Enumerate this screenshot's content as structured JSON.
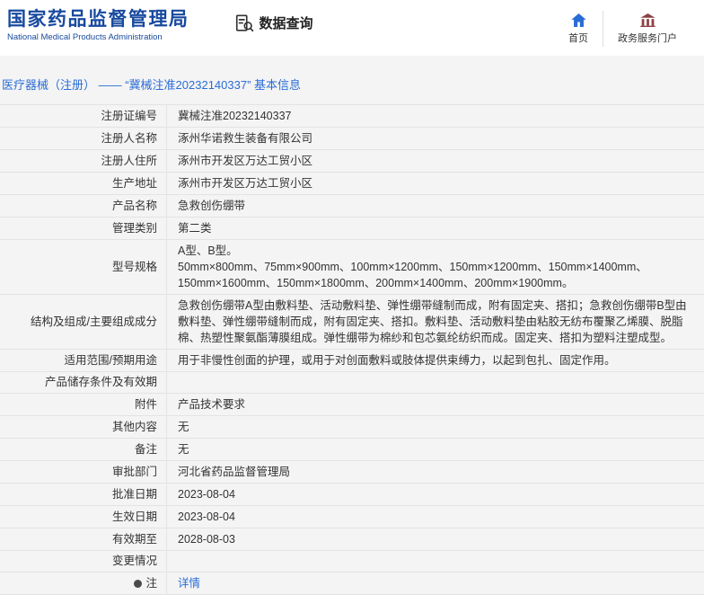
{
  "colors": {
    "logo_blue": "#17499e",
    "breadcrumb_blue": "#2a6cd5",
    "link_blue": "#2a6cd5",
    "portal_icon_red": "#8b4044"
  },
  "header": {
    "logo_title": "国家药品监督管理局",
    "logo_subtitle": "National Medical Products Administration",
    "nav_query": "数据查询",
    "home_label": "首页",
    "portal_label": "政务服务门户"
  },
  "breadcrumb": {
    "text": "医疗器械（注册） ——  “冀械注准20232140337”  基本信息"
  },
  "table": {
    "rows": [
      {
        "label": "注册证编号",
        "value": "冀械注准20232140337"
      },
      {
        "label": "注册人名称",
        "value": "涿州华诺救生装备有限公司"
      },
      {
        "label": "注册人住所",
        "value": "涿州市开发区万达工贸小区"
      },
      {
        "label": "生产地址",
        "value": "涿州市开发区万达工贸小区"
      },
      {
        "label": "产品名称",
        "value": "急救创伤绷带"
      },
      {
        "label": "管理类别",
        "value": "第二类"
      },
      {
        "label": "型号规格",
        "value": "A型、B型。\n50mm×800mm、75mm×900mm、100mm×1200mm、150mm×1200mm、150mm×1400mm、150mm×1600mm、150mm×1800mm、200mm×1400mm、200mm×1900mm。"
      },
      {
        "label": "结构及组成/主要组成成分",
        "value": "急救创伤绷带A型由敷料垫、活动敷料垫、弹性绷带缝制而成，附有固定夹、搭扣；急救创伤绷带B型由敷料垫、弹性绷带缝制而成，附有固定夹、搭扣。敷料垫、活动敷料垫由粘胶无纺布覆聚乙烯膜、脱脂棉、热塑性聚氨酯薄膜组成。弹性绷带为棉纱和包芯氨纶纺织而成。固定夹、搭扣为塑料注塑成型。"
      },
      {
        "label": "适用范围/预期用途",
        "value": "用于非慢性创面的护理，或用于对创面敷料或肢体提供束缚力，以起到包扎、固定作用。"
      },
      {
        "label": "产品储存条件及有效期",
        "value": ""
      },
      {
        "label": "附件",
        "value": "产品技术要求"
      },
      {
        "label": "其他内容",
        "value": "无"
      },
      {
        "label": "备注",
        "value": "无"
      },
      {
        "label": "审批部门",
        "value": "河北省药品监督管理局"
      },
      {
        "label": "批准日期",
        "value": "2023-08-04"
      },
      {
        "label": "生效日期",
        "value": "2023-08-04"
      },
      {
        "label": "有效期至",
        "value": "2028-08-03"
      },
      {
        "label": "变更情况",
        "value": ""
      },
      {
        "label": "注",
        "value": "详情",
        "link": true,
        "icon": true
      }
    ]
  }
}
